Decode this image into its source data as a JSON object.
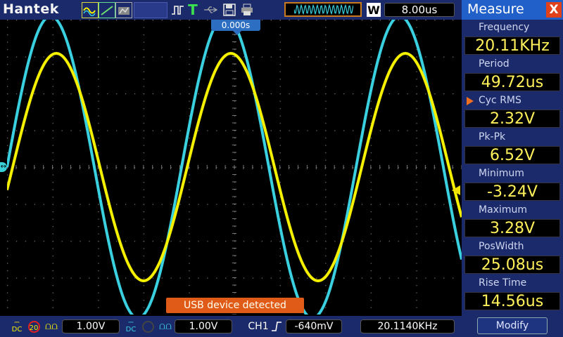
{
  "header": {
    "brand": "Hantek",
    "timebase": "8.00us",
    "W_label": "W",
    "icons": [
      "wave-yellow-icon",
      "wave-green-icon",
      "wave-gray-icon",
      "pulse-icon",
      "trigger-T-icon",
      "usb-icon",
      "save-icon",
      "print-icon"
    ]
  },
  "scope": {
    "trigger_position": "0.000s",
    "usb_toast": "USB device detected",
    "ch1_color": "#f5f000",
    "ch2_color": "#3ad0e0"
  },
  "footer": {
    "ch1_coupling": "DC",
    "ch1_bw": "20",
    "ch1_scale": "1.00V",
    "ch2_coupling": "DC",
    "ch2_scale": "1.00V",
    "trigger_source": "CH1",
    "trigger_level": "-640mV",
    "trigger_freq": "20.1140KHz"
  },
  "measure": {
    "title": "Measure",
    "close": "X",
    "items": [
      {
        "label": "Frequency",
        "value": "20.11KHz"
      },
      {
        "label": "Period",
        "value": "49.72us"
      },
      {
        "label": "Cyc RMS",
        "value": "2.32V"
      },
      {
        "label": "Pk-Pk",
        "value": "6.52V"
      },
      {
        "label": "Minimum",
        "value": "-3.24V"
      },
      {
        "label": "Maximum",
        "value": "3.28V"
      },
      {
        "label": "PosWidth",
        "value": "25.08us"
      },
      {
        "label": "Rise Time",
        "value": "14.56us"
      }
    ],
    "modify_label": "Modify"
  }
}
